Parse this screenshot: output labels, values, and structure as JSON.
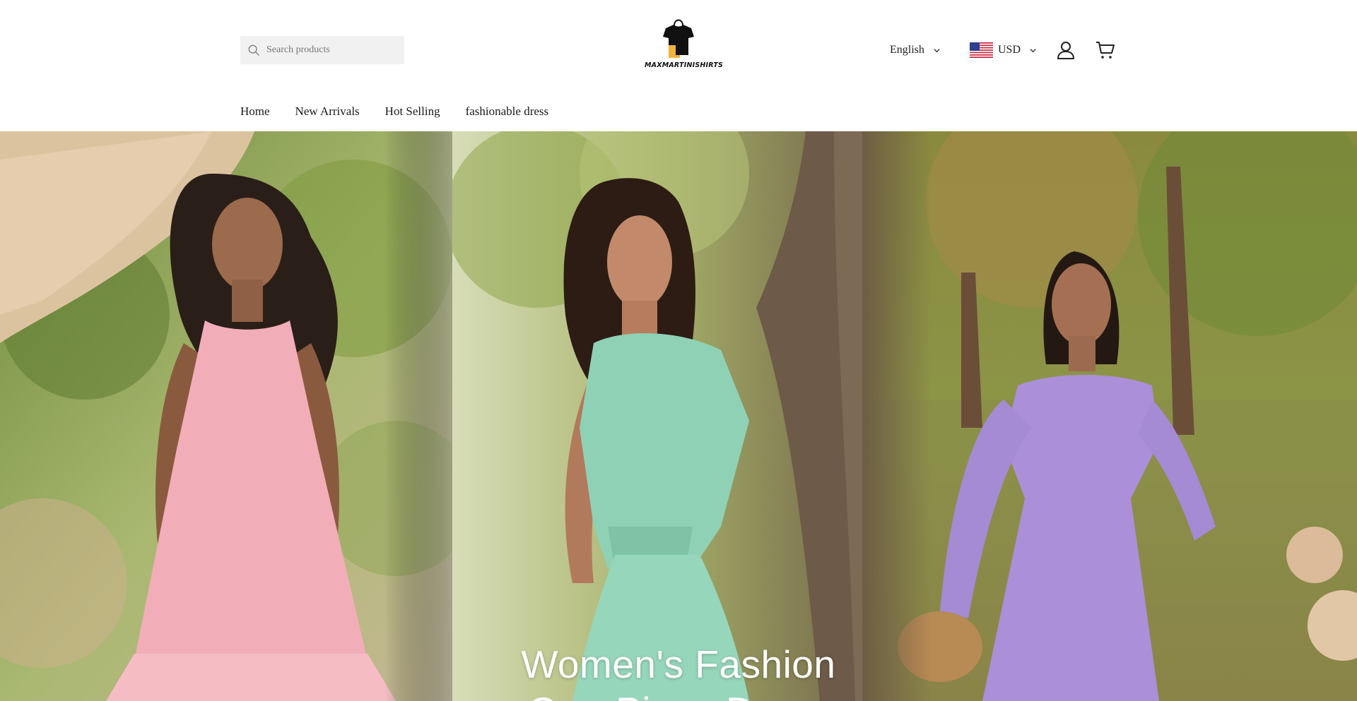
{
  "search": {
    "placeholder": "Search products",
    "icon": "search-icon"
  },
  "logo": {
    "text": "MAXMARTINISHIRTS",
    "icon": "shirt-bag-logo"
  },
  "language": {
    "selected": "English",
    "icon": "chevron-down-icon"
  },
  "currency": {
    "selected": "USD",
    "flag": "us-flag-icon",
    "icon": "chevron-down-icon"
  },
  "header_icons": {
    "account": "user-icon",
    "cart": "cart-icon"
  },
  "nav": {
    "items": [
      {
        "label": "Home"
      },
      {
        "label": "New Arrivals"
      },
      {
        "label": "Hot Selling"
      },
      {
        "label": "fashionable dress"
      }
    ]
  },
  "hero": {
    "title": "Women's Fashion",
    "subtitle_partial": "One-Piece Dress"
  },
  "colors": {
    "accent_text": "#1a1a1a",
    "search_bg": "#f1f1f1",
    "hero_text": "#ffffff",
    "dress_pink": "#f2aeb8",
    "dress_mint": "#8fd1b5",
    "dress_lavender": "#ab8fd8"
  }
}
